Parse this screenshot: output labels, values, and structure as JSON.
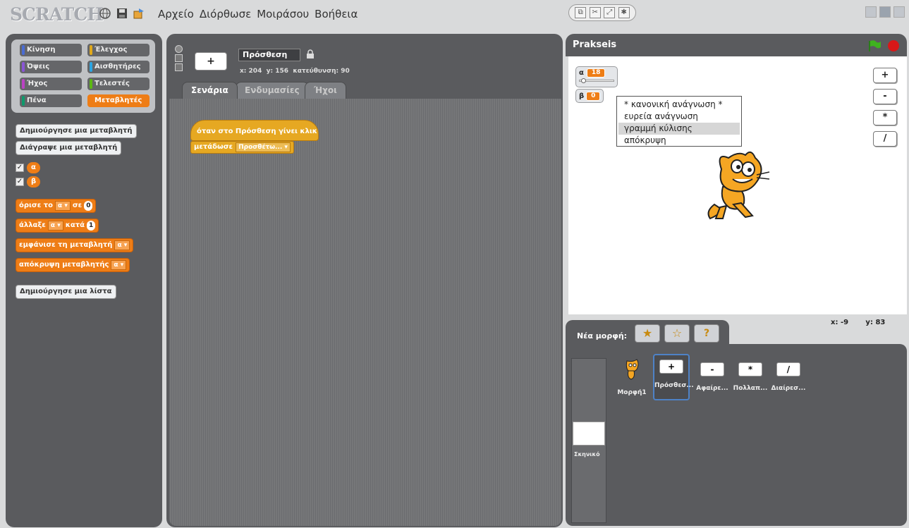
{
  "app": {
    "logo": "SCRATCH"
  },
  "menu": [
    "Αρχείο",
    "Διόρθωσε",
    "Μοιράσου",
    "Βοήθεια"
  ],
  "categories": [
    {
      "label": "Κίνηση",
      "color": "#4a6cd4"
    },
    {
      "label": "Έλεγχος",
      "color": "#e1a91a"
    },
    {
      "label": "Όψεις",
      "color": "#8a55d7"
    },
    {
      "label": "Αισθητήρες",
      "color": "#2ca5e2"
    },
    {
      "label": "Ήχος",
      "color": "#bb42c3"
    },
    {
      "label": "Τελεστές",
      "color": "#5cb712"
    },
    {
      "label": "Πένα",
      "color": "#0e9a6c"
    },
    {
      "label": "Μεταβλητές",
      "color": "#ee7d16"
    }
  ],
  "palette": {
    "make_var": "Δημιούργησε μια μεταβλητή",
    "delete_var": "Διάγραψε μια μεταβλητή",
    "var_a": "α",
    "var_b": "β",
    "set_block": {
      "label": "όρισε το",
      "dropdown": "α",
      "to": "σε",
      "value": "0"
    },
    "change_block": {
      "label": "άλλαξε",
      "dropdown": "α",
      "by": "κατά",
      "value": "1"
    },
    "show_block": {
      "label": "εμφάνισε τη μεταβλητή",
      "dropdown": "α"
    },
    "hide_block": {
      "label": "απόκρυψη μεταβλητής",
      "dropdown": "α"
    },
    "make_list": "Δημιούργησε μια λίστα"
  },
  "sprite": {
    "name": "Πρόσθεση",
    "x_label": "x:",
    "x": "204",
    "y_label": "y:",
    "y": "156",
    "dir_label": "κατεύθυνση:",
    "dir": "90",
    "thumb_symbol": "+"
  },
  "tabs": [
    "Σενάρια",
    "Ενδυμασίες",
    "Ήχοι"
  ],
  "script": {
    "hat": "όταν στο Πρόσθεση γίνει κλικ",
    "broadcast_label": "μετάδωσε",
    "broadcast_value": "Προσθέτω..."
  },
  "stage": {
    "title": "Prakseis",
    "monitor_a": {
      "name": "α",
      "value": "18"
    },
    "monitor_b": {
      "name": "β",
      "value": "0"
    },
    "context_menu": [
      "* κανονική ανάγνωση *",
      "ευρεία ανάγνωση",
      "γραμμή κύλισης",
      "απόκρυψη"
    ],
    "buttons": [
      "+",
      "-",
      "*",
      "/"
    ],
    "mouse_x_label": "x:",
    "mouse_x": "-9",
    "mouse_y_label": "y:",
    "mouse_y": "83"
  },
  "new_sprite_label": "Νέα μορφή:",
  "sprite_list": [
    {
      "name": "Μορφή1",
      "symbol": ""
    },
    {
      "name": "Πρόσθεσ...",
      "symbol": "+"
    },
    {
      "name": "Αφαίρε...",
      "symbol": "-"
    },
    {
      "name": "Πολλαπ...",
      "symbol": "*"
    },
    {
      "name": "Διαίρεσ...",
      "symbol": "/"
    }
  ],
  "stage_thumb_label": "Σκηνικό"
}
